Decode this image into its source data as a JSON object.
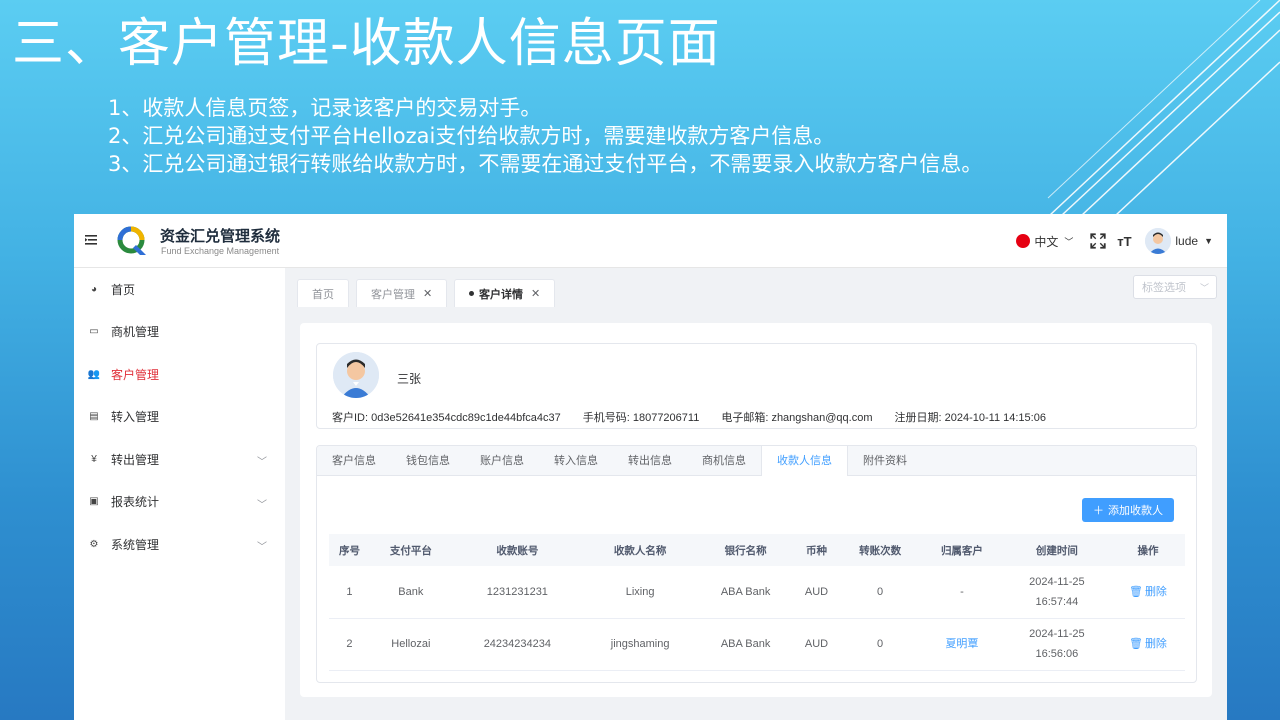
{
  "slide": {
    "title": "三、客户管理-收款人信息页面",
    "points": [
      "1、收款人信息页签，记录该客户的交易对手。",
      "2、汇兑公司通过支付平台Hellozai支付给收款方时，需要建收款方客户信息。",
      "3、汇兑公司通过银行转账给收款方时，不需要在通过支付平台，不需要录入收款方客户信息。"
    ]
  },
  "app": {
    "brand_name": "资金汇兑管理系统",
    "brand_sub": "Fund Exchange Management",
    "language": "中文",
    "username": "lude"
  },
  "sidebar": {
    "items": [
      {
        "label": "首页",
        "icon": "dashboard-icon"
      },
      {
        "label": "商机管理",
        "icon": "book-icon"
      },
      {
        "label": "客户管理",
        "icon": "users-icon"
      },
      {
        "label": "转入管理",
        "icon": "files-icon"
      },
      {
        "label": "转出管理",
        "icon": "yen-icon"
      },
      {
        "label": "报表统计",
        "icon": "monitor-icon"
      },
      {
        "label": "系统管理",
        "icon": "gear-icon"
      }
    ]
  },
  "page_tabs": {
    "home": "首页",
    "customer_mgmt": "客户管理",
    "customer_detail": "客户详情",
    "tag_select_placeholder": "标签选项"
  },
  "customer": {
    "name": "三张",
    "id_line": "客户ID: 0d3e52641e354cdc89c1de44bfca4c37",
    "phone_line": "手机号码: 18077206711",
    "email_line": "电子邮箱: zhangshan@qq.com",
    "reg_line": "注册日期: 2024-10-11 14:15:06"
  },
  "detail_tabs": [
    "客户信息",
    "钱包信息",
    "账户信息",
    "转入信息",
    "转出信息",
    "商机信息",
    "收款人信息",
    "附件资料"
  ],
  "active_detail_tab": "收款人信息",
  "add_button": "添加收款人",
  "table": {
    "headers": [
      "序号",
      "支付平台",
      "收款账号",
      "收款人名称",
      "银行名称",
      "币种",
      "转账次数",
      "归属客户",
      "创建时间",
      "操作"
    ],
    "rows": [
      {
        "no": "1",
        "platform": "Bank",
        "account": "1231231231",
        "payee": "Lixing",
        "bank": "ABA Bank",
        "currency": "AUD",
        "count": "0",
        "owner": "-",
        "date": "2024-11-25",
        "time": "16:57:44",
        "action": "删除"
      },
      {
        "no": "2",
        "platform": "Hellozai",
        "account": "24234234234",
        "payee": "jingshaming",
        "bank": "ABA Bank",
        "currency": "AUD",
        "count": "0",
        "owner": "夏明覃",
        "date": "2024-11-25",
        "time": "16:56:06",
        "action": "删除"
      }
    ]
  },
  "colors": {
    "accent": "#409eff",
    "active_menu": "#e0303a",
    "slide_bg_top": "#5bcdf2",
    "slide_bg_bottom": "#2779c2"
  }
}
